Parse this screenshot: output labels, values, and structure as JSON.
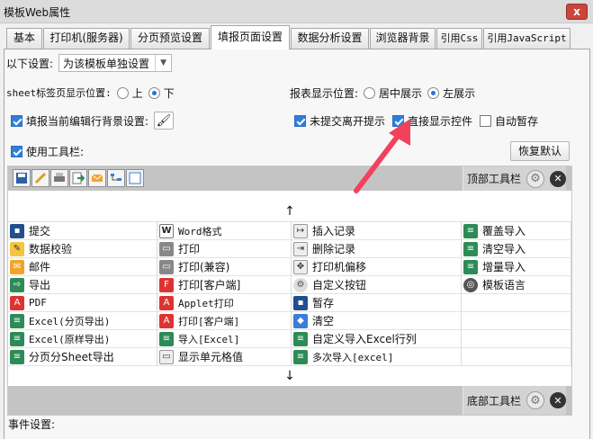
{
  "window": {
    "title": "模板Web属性",
    "close_label": "x"
  },
  "tabs": [
    {
      "label": "基本"
    },
    {
      "label": "打印机(服务器)"
    },
    {
      "label": "分页预览设置"
    },
    {
      "label": "填报页面设置"
    },
    {
      "label": "数据分析设置"
    },
    {
      "label": "浏览器背景"
    },
    {
      "label": "引用Css"
    },
    {
      "label": "引用JavaScript"
    }
  ],
  "settings": {
    "following_label": "以下设置:",
    "following_value": "为该模板单独设置",
    "sheet_position_label": "sheet标签页显示位置:",
    "sheet_top": "上",
    "sheet_bottom": "下",
    "report_position_label": "报表显示位置:",
    "report_center": "居中展示",
    "report_left": "左展示",
    "fill_bg_label": "填报当前编辑行背景设置:",
    "unsubmitted_label": "未提交离开提示",
    "direct_show_label": "直接显示控件",
    "auto_save_label": "自动暂存",
    "use_toolbar_label": "使用工具栏:",
    "restore_default": "恢复默认"
  },
  "toolbar": {
    "top_label": "顶部工具栏",
    "bottom_label": "底部工具栏",
    "up_arrow": "↑",
    "down_arrow": "↓",
    "top_icons": [
      "save-icon",
      "validate-icon",
      "print-icon",
      "export-icon",
      "mail-icon",
      "tree-icon",
      "blank-icon"
    ]
  },
  "buttons": [
    [
      "提交",
      "Word格式",
      "插入记录",
      "覆盖导入"
    ],
    [
      "数据校验",
      "打印",
      "删除记录",
      "清空导入"
    ],
    [
      "邮件",
      "打印(兼容)",
      "打印机偏移",
      "增量导入"
    ],
    [
      "导出",
      "打印[客户端]",
      "自定义按钮",
      "模板语言"
    ],
    [
      "PDF",
      "Applet打印",
      "暂存",
      ""
    ],
    [
      "Excel(分页导出)",
      "打印[客户端]",
      "清空",
      ""
    ],
    [
      "Excel(原样导出)",
      "导入[Excel]",
      "自定义导入Excel行列",
      ""
    ],
    [
      "分页分Sheet导出",
      "显示单元格值",
      "多次导入[excel]",
      ""
    ]
  ],
  "events": {
    "label": "事件设置:"
  },
  "colors": {
    "accent": "#2f7ed8",
    "annotation_arrow": "#f2425b"
  }
}
